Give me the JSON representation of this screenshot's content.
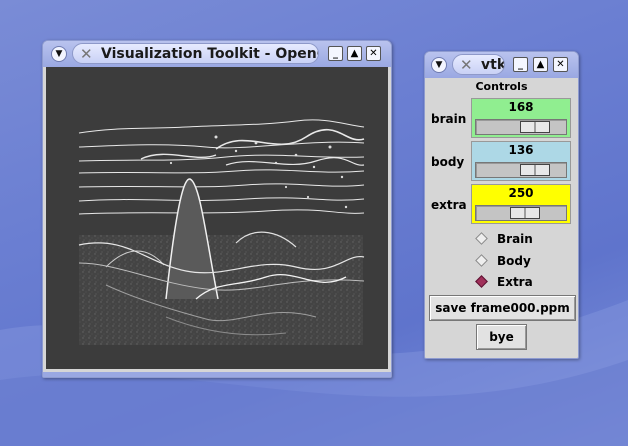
{
  "desktop": {
    "background": "#6b7fd2"
  },
  "vtk_window": {
    "title": "Visualization Toolkit - OpenGL",
    "menu_icon": "chevron-down-icon",
    "buttons": {
      "minimize": "_",
      "maximize": "▲",
      "close": "✕"
    },
    "render_background": "#3c3c3c"
  },
  "controls_window": {
    "title": "vtk",
    "heading": "Controls",
    "scales": [
      {
        "label": "brain",
        "value": "168",
        "color": "#90ee90",
        "fraction": 0.5
      },
      {
        "label": "body",
        "value": "136",
        "color": "#add8e6",
        "fraction": 0.5
      },
      {
        "label": "extra",
        "value": "250",
        "color": "#ffff00",
        "fraction": 0.45
      }
    ],
    "radios": [
      {
        "label": "Brain",
        "selected": false
      },
      {
        "label": "Body",
        "selected": false
      },
      {
        "label": "Extra",
        "selected": true
      }
    ],
    "save_button": "save frame000.ppm",
    "bye_button": "bye"
  }
}
